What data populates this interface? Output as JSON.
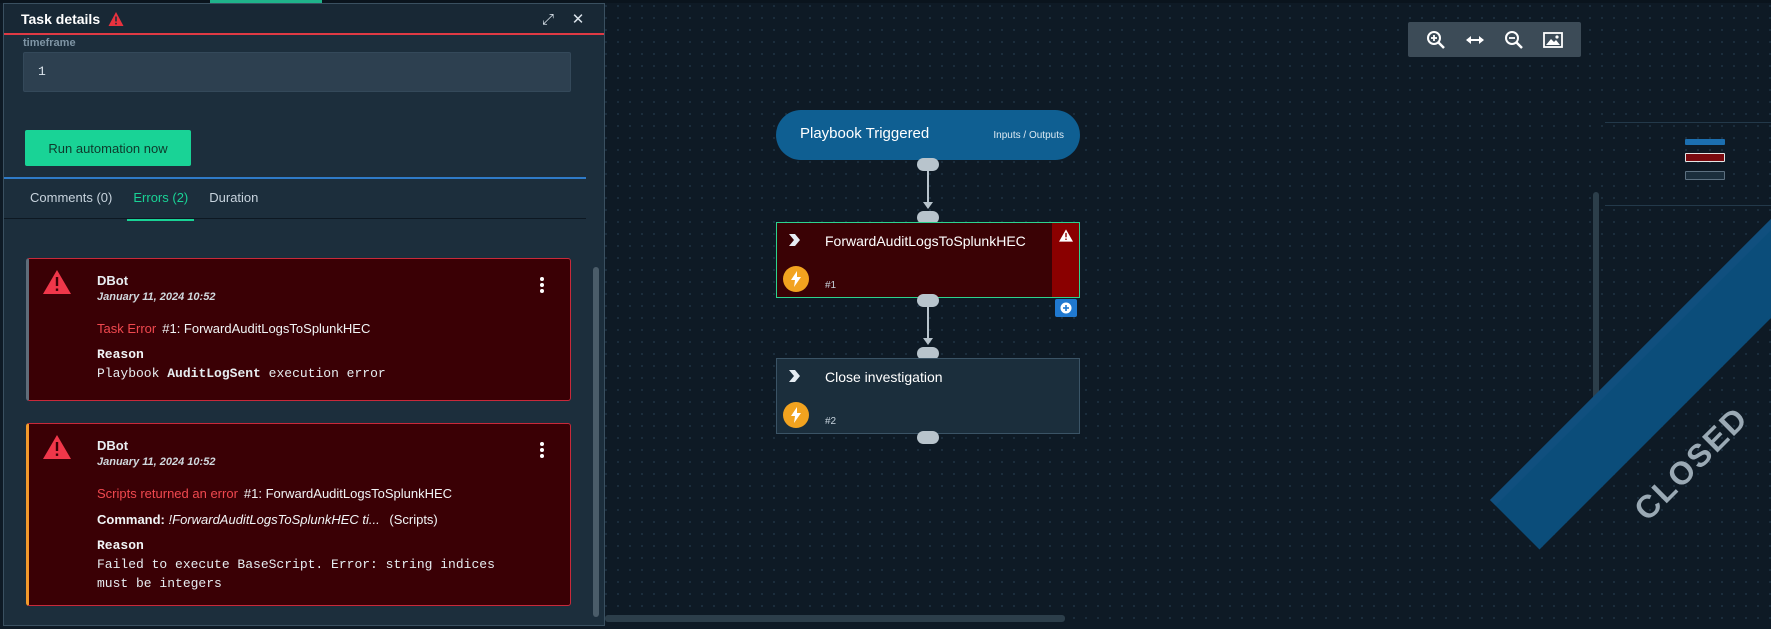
{
  "panel": {
    "title": "Task details",
    "field_label": "timeframe",
    "field_value": "1",
    "run_button": "Run automation now",
    "tabs": [
      {
        "label": "Comments (0)"
      },
      {
        "label": "Errors (2)"
      },
      {
        "label": "Duration"
      }
    ],
    "errors": [
      {
        "author": "DBot",
        "date": "January 11, 2024 10:52",
        "type": "Task Error",
        "task": "#1: ForwardAuditLogsToSplunkHEC",
        "reason_label": "Reason",
        "reason_prefix": "Playbook",
        "reason_bold": "AuditLogSent",
        "reason_suffix": "execution error"
      },
      {
        "author": "DBot",
        "date": "January 11, 2024 10:52",
        "type": "Scripts returned an error",
        "task": "#1: ForwardAuditLogsToSplunkHEC",
        "command_label": "Command:",
        "command_value": "!ForwardAuditLogsToSplunkHEC ti...",
        "command_source": "(Scripts)",
        "reason_label": "Reason",
        "reason_line1": "Failed to execute BaseScript. Error: string indices",
        "reason_line2": "must be integers"
      }
    ]
  },
  "canvas": {
    "trigger": {
      "title": "Playbook Triggered",
      "io_link": "Inputs / Outputs"
    },
    "tasks": [
      {
        "title": "ForwardAuditLogsToSplunkHEC",
        "num": "#1"
      },
      {
        "title": "Close investigation",
        "num": "#2"
      }
    ],
    "status_ribbon": "CLOSED"
  },
  "colors": {
    "accent_green": "#19d396",
    "error_red": "#c8293a",
    "warning_orange": "#f39a2b",
    "trigger_blue": "#0f5f92"
  }
}
